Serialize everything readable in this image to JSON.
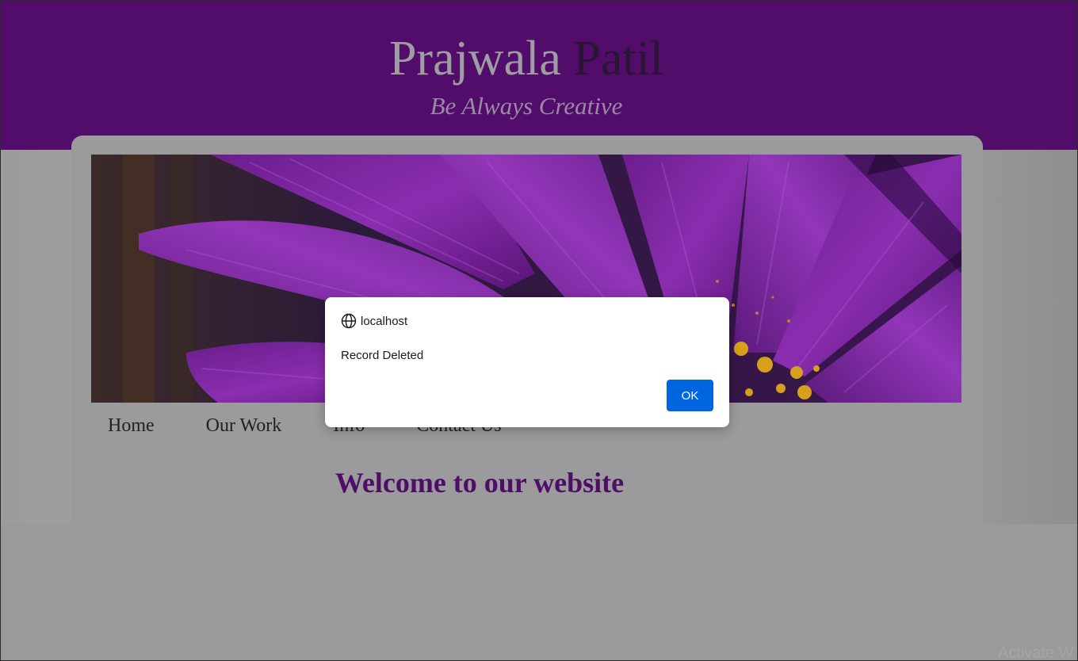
{
  "site": {
    "title_first": "Prajwala",
    "title_last": "Patil",
    "tagline": "Be Always Creative"
  },
  "nav": {
    "items": [
      "Home",
      "Our Work",
      "Info",
      "Contact Us"
    ]
  },
  "main": {
    "welcome_heading": "Welcome to our website"
  },
  "dialog": {
    "origin": "localhost",
    "message": "Record Deleted",
    "ok_label": "OK"
  },
  "os": {
    "watermark": "Activate W"
  },
  "colors": {
    "header_purple": "#520d6b",
    "welcome_purple": "#4f0e66",
    "dialog_button_blue": "#0066e0"
  },
  "banner": {
    "image": "purple-daisy-flower-photo"
  }
}
